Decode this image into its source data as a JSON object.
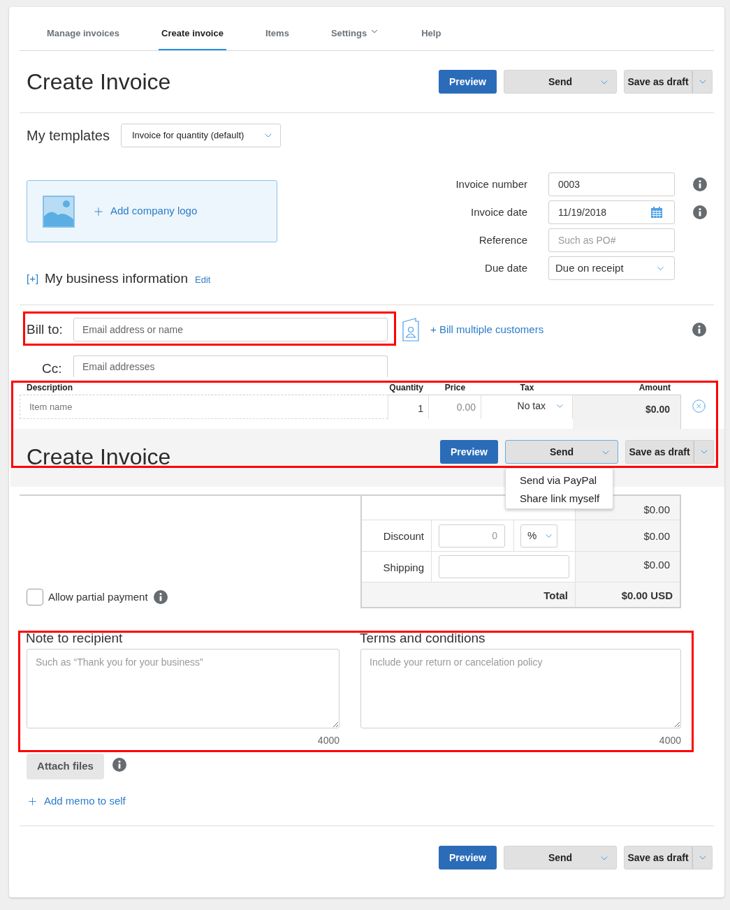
{
  "nav": {
    "tabs": [
      {
        "label": "Manage invoices",
        "selected": false,
        "has_menu": false
      },
      {
        "label": "Create invoice",
        "selected": true,
        "has_menu": false
      },
      {
        "label": "Items",
        "selected": false,
        "has_menu": false
      },
      {
        "label": "Settings",
        "selected": false,
        "has_menu": true
      },
      {
        "label": "Help",
        "selected": false,
        "has_menu": false
      }
    ]
  },
  "header": {
    "title": "Create Invoice",
    "buttons": {
      "preview": "Preview",
      "send": "Send",
      "save": "Save as draft"
    }
  },
  "templates": {
    "label": "My templates",
    "value": "Invoice for quantity (default)"
  },
  "logo": {
    "label": "Add company logo"
  },
  "business": {
    "toggle": "[+]",
    "label": "My business information",
    "edit": "Edit"
  },
  "fields": [
    {
      "label": "Invoice number",
      "kind": "text",
      "value": "0003",
      "info": true
    },
    {
      "label": "Invoice date",
      "kind": "date",
      "value": "11/19/2018",
      "info": true
    },
    {
      "label": "Reference",
      "kind": "text",
      "placeholder": "Such as PO#",
      "info": false
    },
    {
      "label": "Due date",
      "kind": "select",
      "value": "Due on receipt",
      "info": false
    }
  ],
  "bill_to": {
    "label": "Bill to:",
    "placeholder": "Email address or name",
    "multiple": "+ Bill multiple customers"
  },
  "cc": {
    "label": "Cc:",
    "placeholder": "Email addresses"
  },
  "items": {
    "columns": [
      "Description",
      "Quantity",
      "Price",
      "Tax",
      "Amount"
    ],
    "rows": [
      {
        "placeholder": "Item name",
        "quantity": "1",
        "price_placeholder": "0.00",
        "tax": "No tax",
        "amount": "$0.00"
      }
    ]
  },
  "sticky_header": {
    "title": "Create Invoice",
    "buttons": {
      "preview": "Preview",
      "send": "Send",
      "save": "Save as draft"
    },
    "send_open": true,
    "send_menu": [
      "Send via PayPal",
      "Share link myself"
    ]
  },
  "totals": {
    "subtotal": "$0.00",
    "discount": {
      "label": "Discount",
      "placeholder": "0",
      "unit": "%",
      "amount": "$0.00"
    },
    "shipping": {
      "label": "Shipping",
      "amount": "$0.00"
    },
    "total": {
      "label": "Total",
      "amount": "$0.00 USD"
    }
  },
  "partial_payment": {
    "label": "Allow partial payment",
    "checked": false
  },
  "note": {
    "label": "Note to recipient",
    "placeholder": "Such as “Thank you for your business”",
    "count": "4000"
  },
  "terms": {
    "label": "Terms and conditions",
    "placeholder": "Include your return or cancelation policy",
    "count": "4000"
  },
  "attach": {
    "label": "Attach files"
  },
  "memo": {
    "label": "Add memo to self"
  },
  "footer": {
    "buttons": {
      "preview": "Preview",
      "send": "Send",
      "save": "Save as draft"
    }
  }
}
